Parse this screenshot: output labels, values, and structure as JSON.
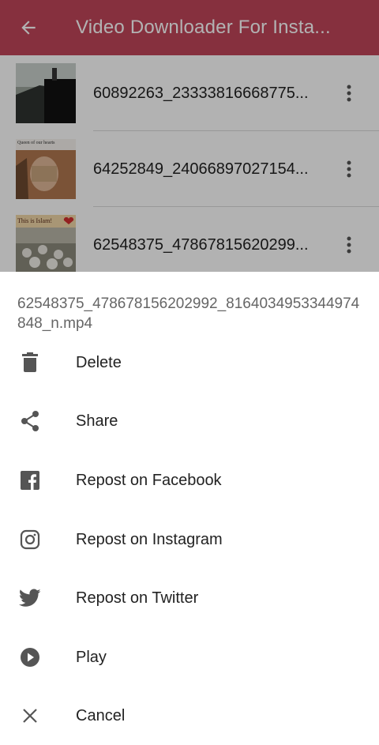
{
  "appbar": {
    "title": "Video Downloader For Insta...",
    "color": "#c0455a"
  },
  "list": {
    "items": [
      {
        "filename": "60892263_23333816668775...",
        "thumb_caption": ""
      },
      {
        "filename": "64252849_24066897027154...",
        "thumb_caption": "Queen of our hearts"
      },
      {
        "filename": "62548375_47867815620299...",
        "thumb_caption": "This is Islam!"
      }
    ]
  },
  "sheet": {
    "title": "62548375_478678156202992_8164034953344974848_n.mp4",
    "actions": [
      {
        "label": "Delete",
        "icon": "trash-icon"
      },
      {
        "label": "Share",
        "icon": "share-icon"
      },
      {
        "label": "Repost on Facebook",
        "icon": "facebook-icon"
      },
      {
        "label": "Repost on Instagram",
        "icon": "instagram-icon"
      },
      {
        "label": "Repost on Twitter",
        "icon": "twitter-icon"
      },
      {
        "label": "Play",
        "icon": "play-circle-icon"
      },
      {
        "label": "Cancel",
        "icon": "close-icon"
      }
    ]
  }
}
